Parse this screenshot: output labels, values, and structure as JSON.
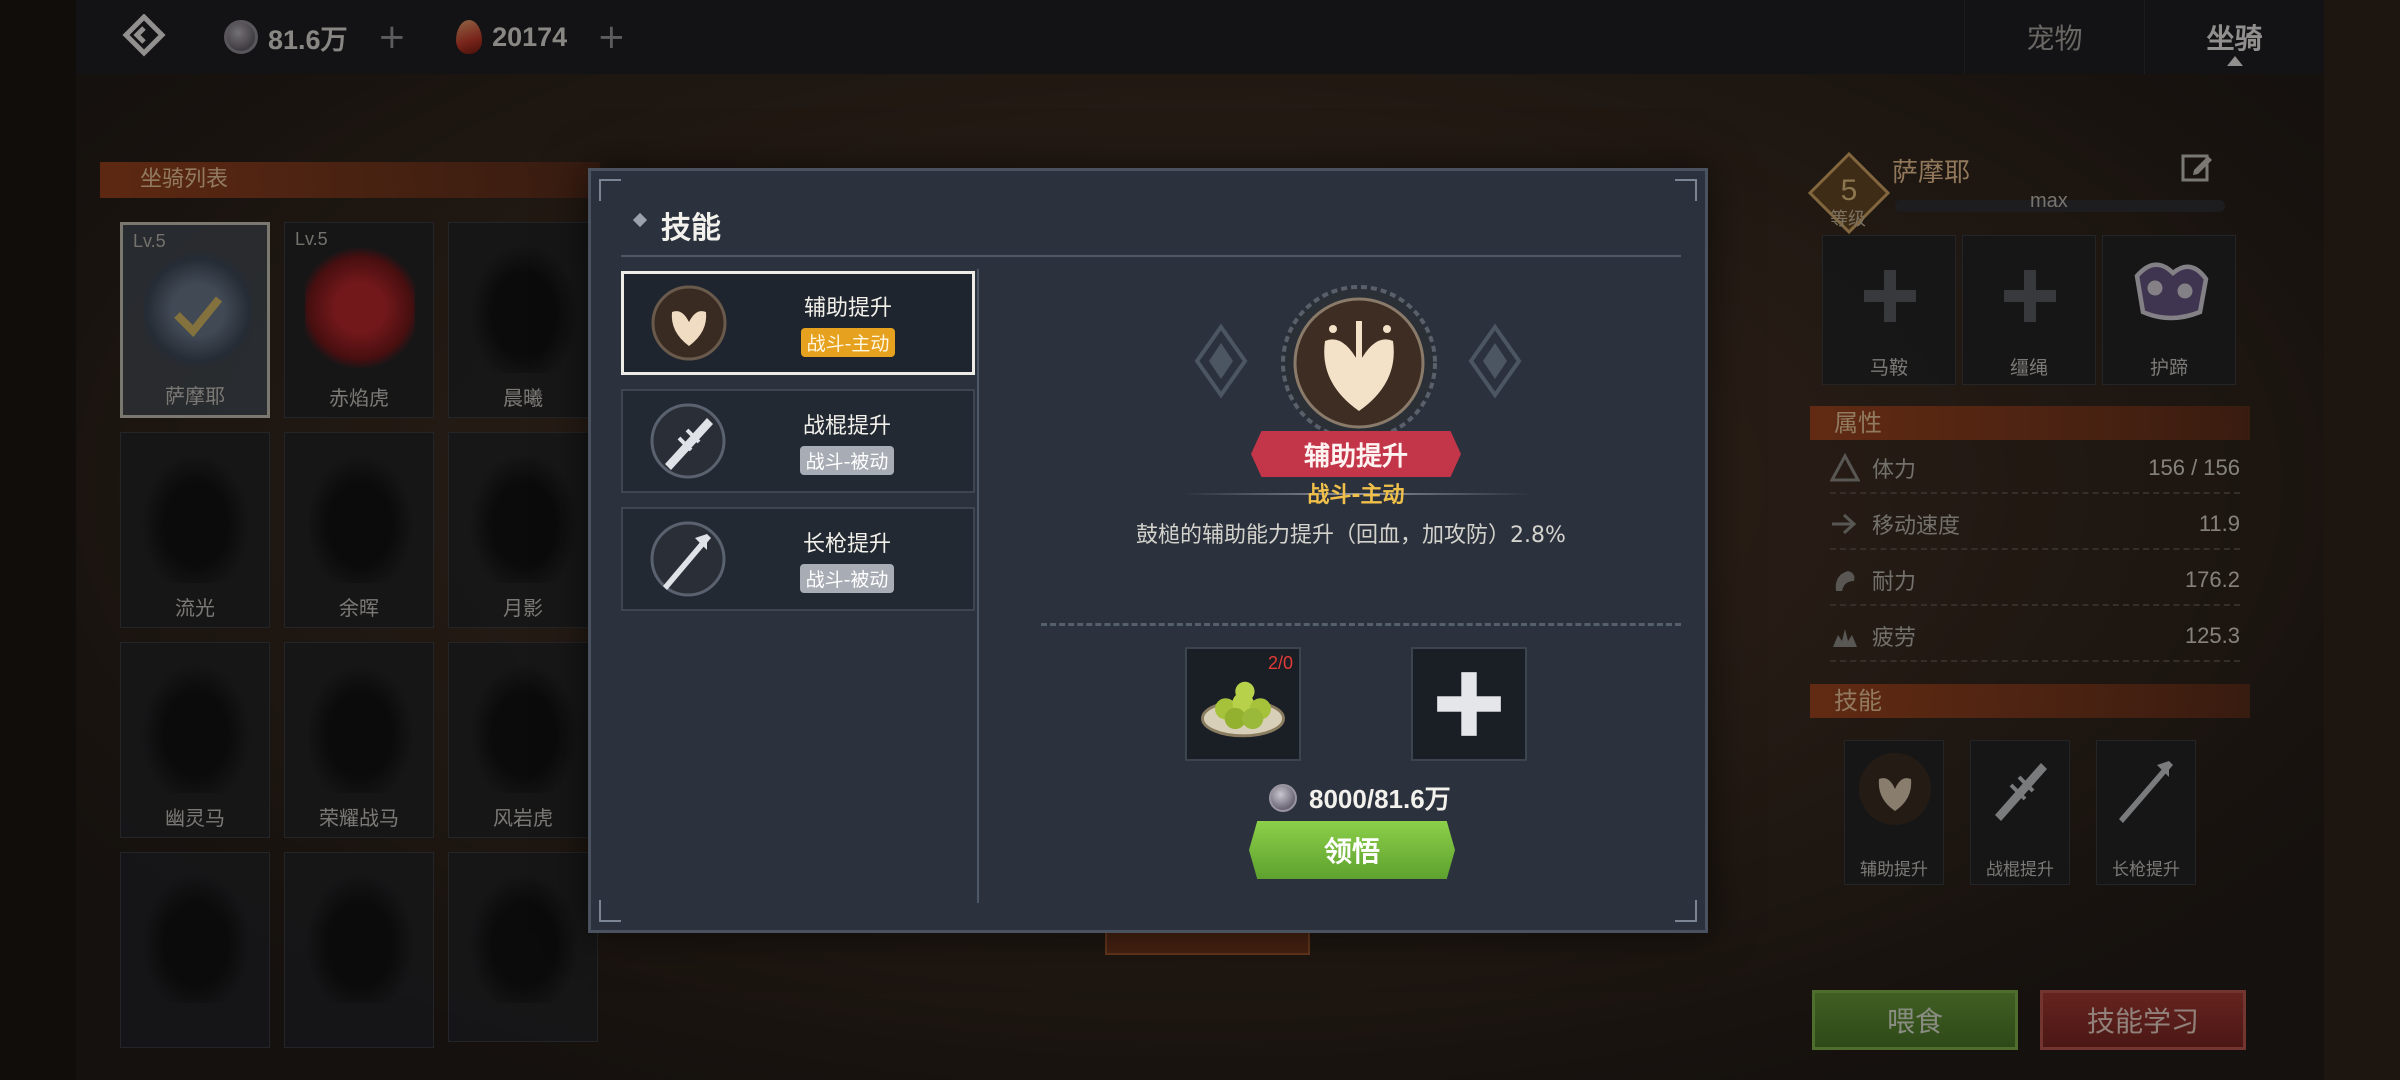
{
  "currencies": [
    {
      "icon": "silver-coin-icon",
      "value": "81.6万"
    },
    {
      "icon": "red-gem-icon",
      "value": "20174"
    }
  ],
  "tabs": [
    {
      "label": "宠物",
      "active": false
    },
    {
      "label": "坐骑",
      "active": true
    }
  ],
  "mount_list": {
    "title": "坐骑列表",
    "items": [
      {
        "name": "萨摩耶",
        "level": "Lv.5",
        "selected": true
      },
      {
        "name": "赤焰虎",
        "level": "Lv.5",
        "selected": false
      },
      {
        "name": "晨曦",
        "level": "",
        "selected": false
      },
      {
        "name": "流光",
        "level": "",
        "selected": false
      },
      {
        "name": "余晖",
        "level": "",
        "selected": false
      },
      {
        "name": "月影",
        "level": "",
        "selected": false
      },
      {
        "name": "幽灵马",
        "level": "",
        "selected": false
      },
      {
        "name": "荣耀战马",
        "level": "",
        "selected": false
      },
      {
        "name": "风岩虎",
        "level": "",
        "selected": false
      },
      {
        "name": "",
        "level": "",
        "selected": false
      },
      {
        "name": "",
        "level": "",
        "selected": false
      },
      {
        "name": "",
        "level": "",
        "selected": false
      }
    ]
  },
  "mount_info": {
    "level": "5",
    "level_label": "等级",
    "name": "萨摩耶",
    "exp_text": "max",
    "equipment": [
      {
        "label": "马鞍",
        "empty": true
      },
      {
        "label": "缰绳",
        "empty": true
      },
      {
        "label": "护蹄",
        "empty": false
      }
    ],
    "attributes_title": "属性",
    "attributes": [
      {
        "icon": "stamina-icon",
        "name": "体力",
        "value": "156 / 156"
      },
      {
        "icon": "speed-icon",
        "name": "移动速度",
        "value": "11.9"
      },
      {
        "icon": "endurance-icon",
        "name": "耐力",
        "value": "176.2"
      },
      {
        "icon": "fatigue-icon",
        "name": "疲劳",
        "value": "125.3"
      }
    ],
    "skills_title": "技能",
    "skills": [
      {
        "icon": "assist-boost-icon",
        "label": "辅助提升"
      },
      {
        "icon": "staff-boost-icon",
        "label": "战棍提升"
      },
      {
        "icon": "spear-boost-icon",
        "label": "长枪提升"
      }
    ],
    "feed_button": "喂食",
    "learn_button": "技能学习"
  },
  "skill_modal": {
    "title": "技能",
    "skills": [
      {
        "name": "辅助提升",
        "tag": "战斗-主动",
        "kind": "active",
        "selected": true,
        "icon": "assist-boost-icon"
      },
      {
        "name": "战棍提升",
        "tag": "战斗-被动",
        "kind": "passive",
        "selected": false,
        "icon": "staff-boost-icon"
      },
      {
        "name": "长枪提升",
        "tag": "战斗-被动",
        "kind": "passive",
        "selected": false,
        "icon": "spear-boost-icon"
      }
    ],
    "detail": {
      "name": "辅助提升",
      "tag": "战斗-主动",
      "description": "鼓槌的辅助能力提升（回血，加攻防）2.8%",
      "material_count": "2/0",
      "cost": "8000/81.6万",
      "button": "领悟"
    }
  },
  "colors": {
    "accent_orange": "#af481e",
    "active_tag": "#e6a21f",
    "passive_tag": "#a8adb5",
    "ribbon_red": "#c3364a",
    "green_button": "#6ba53a",
    "red_button": "#b03a34"
  }
}
